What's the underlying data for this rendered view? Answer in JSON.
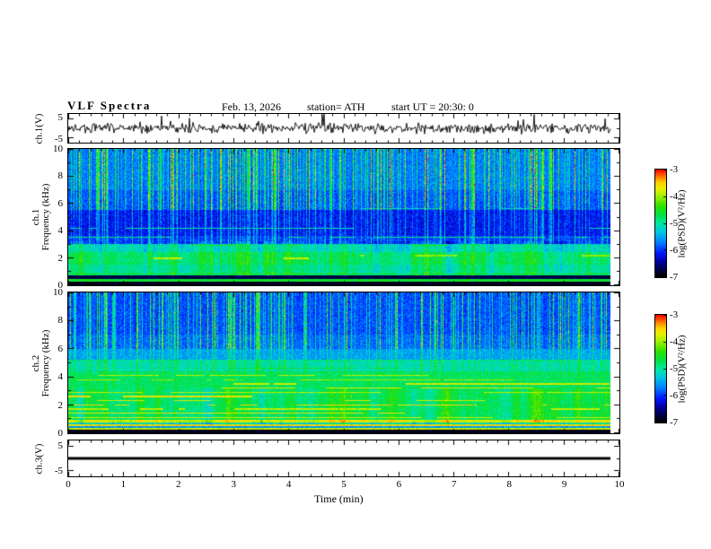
{
  "header": {
    "title": "VLF Spectra",
    "date": "Feb. 13, 2026",
    "station": "station= ATH",
    "start_ut": "start UT =  20:30: 0"
  },
  "labels": {
    "ch1v": "ch.1(V)",
    "ch1": "ch.1",
    "ch2": "ch.2",
    "freq_khz": "Frequency (kHz)",
    "ch3v": "ch.3(V)",
    "colorbar": "log(PSD)(V²/Hz)"
  },
  "axes": {
    "xlabel": "Time (min)",
    "x_tick_labels": [
      "0",
      "1",
      "2",
      "3",
      "4",
      "5",
      "6",
      "7",
      "8",
      "9",
      "10"
    ],
    "spec_y_values": [
      0,
      2,
      4,
      6,
      8,
      10
    ],
    "spec_y_tick_labels": [
      "0",
      "2",
      "4",
      "6",
      "8",
      "10"
    ],
    "wave_y_tick_labels": [
      "5",
      "-5"
    ],
    "colorbar_tick_labels": [
      "-3",
      "-4",
      "-5",
      "-6",
      "-7"
    ]
  },
  "chart_data": [
    {
      "type": "line",
      "panel": "ch.1(V) waveform",
      "x_range_min": [
        0,
        10
      ],
      "y_axis_ticks": [
        5,
        -5
      ],
      "summary": "broadband noisy voltage trace fluctuating about 0 V with random spikes, data ends near 9.85 min"
    },
    {
      "type": "heatmap",
      "panel": "ch.1 spectrogram",
      "ylabel": "ch.1 Frequency (kHz)",
      "xlabel": "Time (min)",
      "x_range_min": [
        0,
        10
      ],
      "y_range_khz": [
        0,
        10
      ],
      "colorbar": {
        "label": "log(PSD)(V²/Hz)",
        "ticks": [
          -3,
          -4,
          -5,
          -6,
          -7
        ],
        "min": -7,
        "max": -3
      },
      "summary": "dense vertical sferic streaks (green/yellow) over blue above 5.5 kHz; dark blue band 3-5.5 kHz; green band 1-3 kHz with intermittent red/orange lines near 2 kHz; black band below 0.5 kHz with a thin green line"
    },
    {
      "type": "heatmap",
      "panel": "ch.2 spectrogram",
      "ylabel": "ch.2 Frequency (kHz)",
      "xlabel": "Time (min)",
      "x_range_min": [
        0,
        10
      ],
      "y_range_khz": [
        0,
        10
      ],
      "colorbar": {
        "label": "log(PSD)(V²/Hz)",
        "ticks": [
          -3,
          -4,
          -5,
          -6,
          -7
        ],
        "min": -7,
        "max": -3
      },
      "summary": "strong red/orange horizontal harmonic stripes over green below 4.5 kHz; blue/dark background with vertical sferic streaks above 6 kHz; black band at the very bottom"
    },
    {
      "type": "line",
      "panel": "ch.3(V) waveform",
      "x_range_min": [
        0,
        10
      ],
      "y_axis_ticks": [
        5,
        -5
      ],
      "summary": "flat thick black line at 0 V (channel silent)"
    }
  ],
  "render": {
    "colormap": [
      [
        0.0,
        "#000000"
      ],
      [
        0.06,
        "#000040"
      ],
      [
        0.14,
        "#0000a0"
      ],
      [
        0.22,
        "#0018ff"
      ],
      [
        0.32,
        "#0080ff"
      ],
      [
        0.42,
        "#00c8e0"
      ],
      [
        0.5,
        "#00e8a0"
      ],
      [
        0.58,
        "#00e040"
      ],
      [
        0.66,
        "#30e000"
      ],
      [
        0.74,
        "#90f000"
      ],
      [
        0.82,
        "#e8f000"
      ],
      [
        0.88,
        "#ffd000"
      ],
      [
        0.94,
        "#ff7000"
      ],
      [
        1.0,
        "#ff0000"
      ]
    ],
    "wave1": {
      "seed": 5,
      "amp": 7,
      "spike_p": 0.03,
      "spike_mult": 2.8,
      "end": 0.985
    },
    "wave3": {
      "end": 0.985,
      "thickness": 3
    },
    "spec1": {
      "seed": 11,
      "noise": 0.13,
      "streak_density": 0.42,
      "streak_strength": 0.5,
      "end": 0.985,
      "bands": [
        [
          0.0,
          0.022,
          0.02
        ],
        [
          0.022,
          0.04,
          0.6
        ],
        [
          0.04,
          0.07,
          0.06
        ],
        [
          0.07,
          0.092,
          0.55
        ],
        [
          0.092,
          0.15,
          0.5
        ],
        [
          0.15,
          0.24,
          0.54
        ],
        [
          0.24,
          0.3,
          0.46
        ],
        [
          0.3,
          0.36,
          0.24
        ],
        [
          0.36,
          0.55,
          0.2
        ],
        [
          0.55,
          0.7,
          0.26
        ],
        [
          0.7,
          1.001,
          0.3
        ]
      ],
      "lines": [
        [
          0.195,
          0.006,
          0.8,
          0.55
        ],
        [
          0.215,
          0.004,
          0.74,
          0.35
        ],
        [
          0.29,
          0.003,
          0.62,
          0.3
        ],
        [
          0.35,
          0.004,
          0.52,
          0.45
        ],
        [
          0.42,
          0.003,
          0.48,
          0.4
        ],
        [
          0.5,
          0.003,
          0.46,
          0.35
        ],
        [
          0.56,
          0.003,
          0.44,
          0.3
        ]
      ],
      "streak_bands": [
        [
          0.0,
          0.07,
          0.05
        ],
        [
          0.07,
          0.3,
          0.18
        ],
        [
          0.3,
          0.55,
          0.45
        ],
        [
          0.55,
          1.001,
          1.0
        ]
      ]
    },
    "spec2": {
      "seed": 22,
      "noise": 0.13,
      "streak_density": 0.4,
      "streak_strength": 0.48,
      "end": 0.985,
      "bands": [
        [
          0.0,
          0.02,
          0.02
        ],
        [
          0.02,
          0.034,
          0.78
        ],
        [
          0.034,
          0.048,
          0.35
        ],
        [
          0.048,
          0.062,
          0.85
        ],
        [
          0.062,
          0.076,
          0.45
        ],
        [
          0.076,
          0.09,
          0.8
        ],
        [
          0.09,
          0.44,
          0.55
        ],
        [
          0.44,
          0.52,
          0.47
        ],
        [
          0.52,
          0.6,
          0.36
        ],
        [
          0.6,
          0.7,
          0.28
        ],
        [
          0.7,
          1.001,
          0.25
        ]
      ],
      "lines": [
        [
          0.11,
          0.004,
          0.8,
          0.6
        ],
        [
          0.14,
          0.004,
          0.84,
          0.55
        ],
        [
          0.17,
          0.004,
          0.78,
          0.6
        ],
        [
          0.2,
          0.004,
          0.86,
          0.6
        ],
        [
          0.23,
          0.004,
          0.8,
          0.5
        ],
        [
          0.26,
          0.004,
          0.84,
          0.55
        ],
        [
          0.29,
          0.004,
          0.78,
          0.5
        ],
        [
          0.32,
          0.004,
          0.82,
          0.5
        ],
        [
          0.35,
          0.004,
          0.8,
          0.5
        ],
        [
          0.38,
          0.004,
          0.76,
          0.45
        ],
        [
          0.41,
          0.004,
          0.78,
          0.45
        ],
        [
          0.46,
          0.003,
          0.6,
          0.4
        ],
        [
          0.52,
          0.003,
          0.55,
          0.35
        ],
        [
          0.58,
          0.003,
          0.5,
          0.3
        ]
      ],
      "streak_bands": [
        [
          0.0,
          0.09,
          0.04
        ],
        [
          0.09,
          0.44,
          0.12
        ],
        [
          0.44,
          0.6,
          0.35
        ],
        [
          0.6,
          1.001,
          0.95
        ]
      ]
    }
  }
}
